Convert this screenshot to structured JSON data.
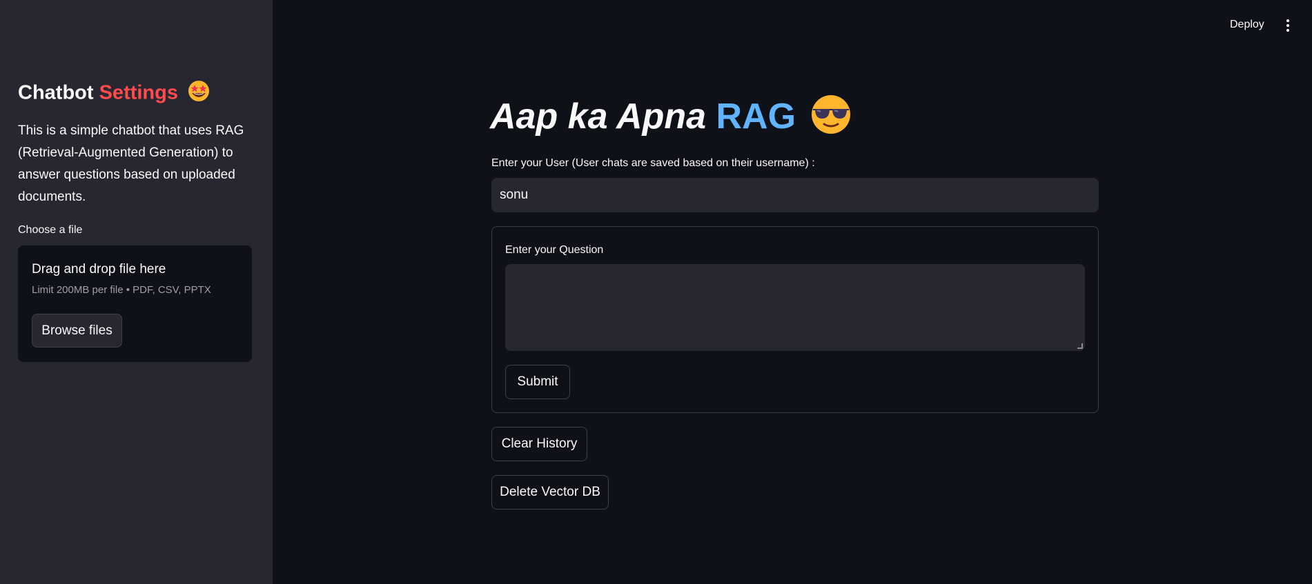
{
  "header": {
    "deploy_label": "Deploy",
    "menu_icon": "vertical-dots-icon"
  },
  "sidebar": {
    "title_part1": "Chatbot",
    "title_part2": "Settings",
    "title_emoji": "star-struck-emoji",
    "description": "This is a simple chatbot that uses RAG (Retrieval-Augmented Generation) to answer questions based on uploaded documents.",
    "file_label": "Choose a file",
    "dropzone": {
      "title": "Drag and drop file here",
      "limit": "Limit 200MB per file • PDF, CSV, PPTX",
      "browse_label": "Browse files"
    }
  },
  "main": {
    "title_part1": "Aap ka Apna",
    "title_part2": "RAG",
    "title_emoji": "smiling-face-with-sunglasses-emoji",
    "user_label": "Enter your User (User chats are saved based on their username) :",
    "user_value": "sonu",
    "question_label": "Enter your Question",
    "question_value": "",
    "submit_label": "Submit",
    "clear_label": "Clear History",
    "delete_label": "Delete Vector DB"
  },
  "colors": {
    "background": "#0e1117",
    "sidebar": "#262730",
    "accent_red": "#ff4b4b",
    "accent_blue": "#60b4ff"
  }
}
